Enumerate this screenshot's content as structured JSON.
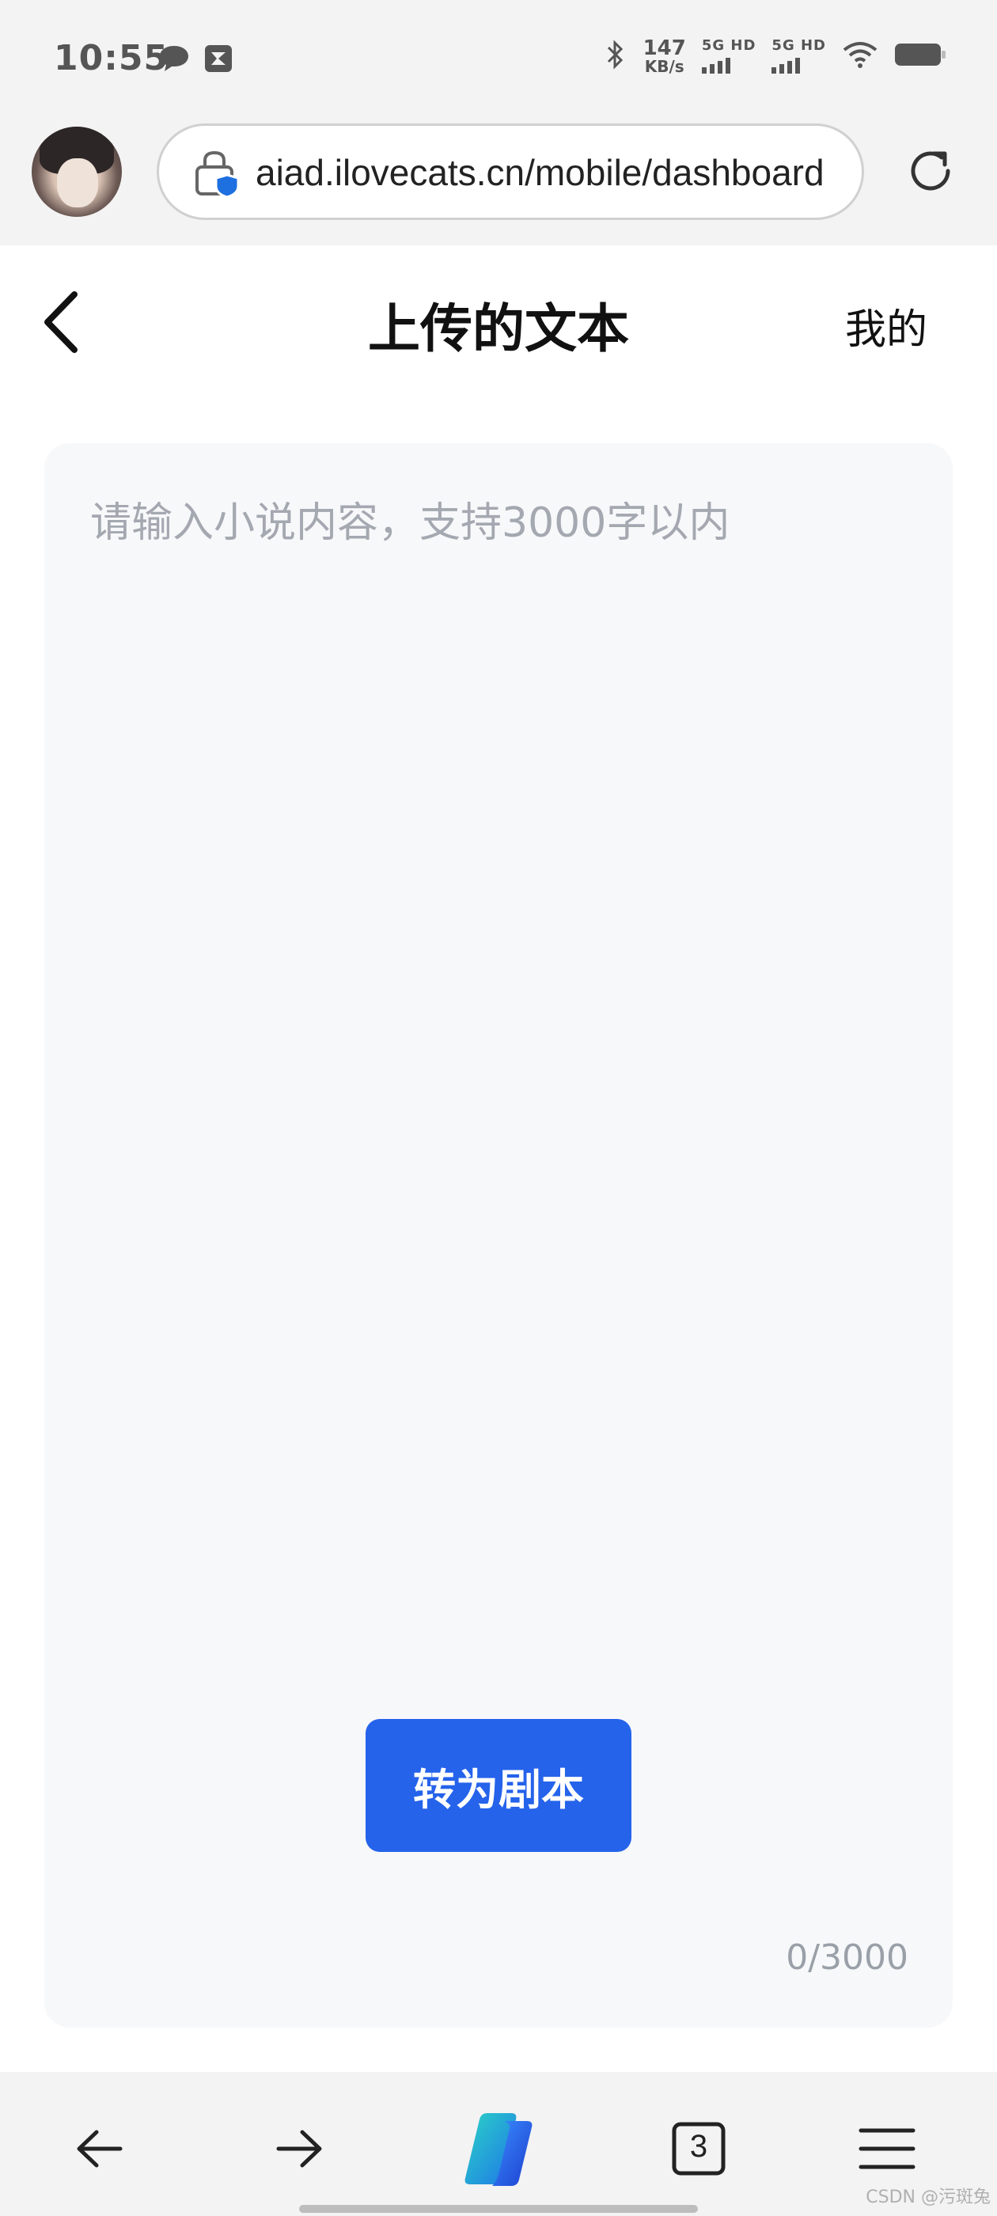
{
  "status_bar": {
    "time": "10:55",
    "net_speed_value": "147",
    "net_speed_unit": "KB/s",
    "sim1_label": "5G HD",
    "sim2_label": "5G HD"
  },
  "browser": {
    "url": "aiad.ilovecats.cn/mobile/dashboard",
    "tab_count": "3"
  },
  "header": {
    "title": "上传的文本",
    "mine_link": "我的"
  },
  "editor": {
    "placeholder": "请输入小说内容，支持3000字以内",
    "value": "",
    "counter": "0/3000",
    "convert_button": "转为剧本"
  },
  "watermark": "CSDN @污斑兔",
  "colors": {
    "primary_button": "#2563eb",
    "editor_background": "#f7f8fa",
    "chrome_background": "#f3f3f3"
  }
}
